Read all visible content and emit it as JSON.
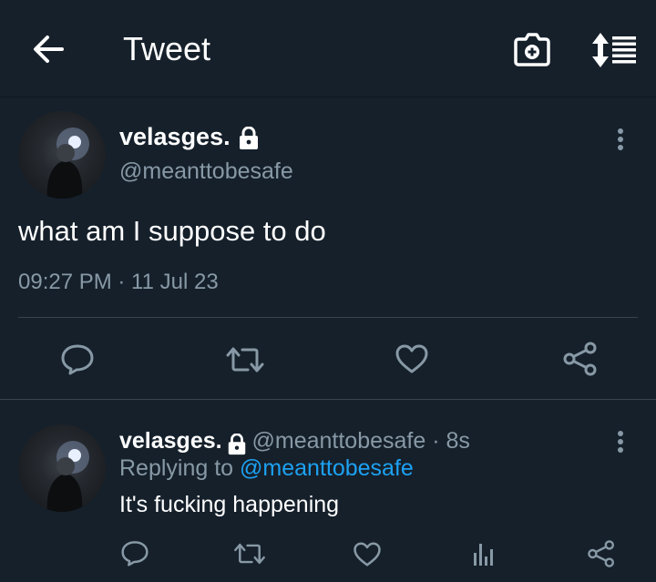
{
  "header": {
    "title": "Tweet",
    "icons": [
      "back-arrow-icon",
      "camera-add-icon",
      "sort-icon"
    ]
  },
  "tweet": {
    "display_name": "velasges.",
    "handle": "@meanttobesafe",
    "text": "what am I suppose to do",
    "timestamp": "09:27 PM · 11 Jul 23",
    "actions": [
      "reply-icon",
      "retweet-icon",
      "like-icon",
      "share-icon"
    ]
  },
  "reply": {
    "display_name": "velasges.",
    "meta": "@meanttobesafe · 8s",
    "replying_prefix": "Replying to",
    "replying_to": "@meanttobesafe",
    "text": "It's fucking happening",
    "actions": [
      "reply-icon",
      "retweet-icon",
      "like-icon",
      "analytics-icon",
      "share-icon"
    ]
  },
  "colors": {
    "background": "#15202b",
    "secondary_text": "#8899a6",
    "accent": "#1da1f2",
    "divider": "#38444d"
  }
}
